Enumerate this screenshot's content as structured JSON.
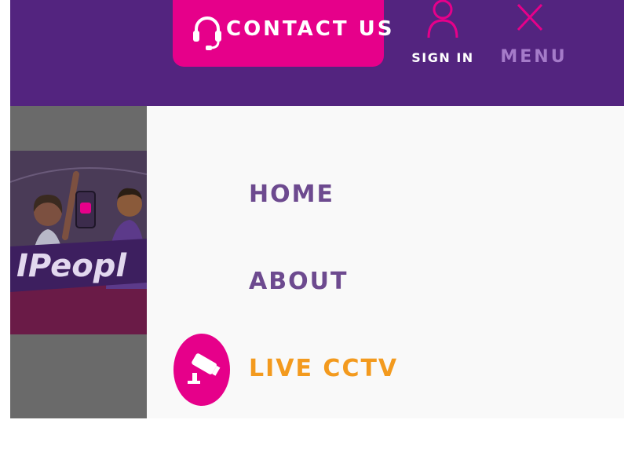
{
  "header": {
    "contact_label": "CONTACT US",
    "signin_label": "SIGN IN",
    "menu_label": "MENU",
    "icons": {
      "contact": "headset-icon",
      "signin": "user-icon",
      "menu": "close-icon"
    }
  },
  "hero": {
    "text": "IPeopl"
  },
  "drawer": {
    "items": [
      {
        "label": "HOME"
      },
      {
        "label": "ABOUT"
      },
      {
        "label": "LIVE CCTV",
        "icon": "cctv-camera-icon",
        "active": true
      }
    ]
  },
  "colors": {
    "brand_purple": "#53247f",
    "brand_pink": "#e6008a",
    "accent_orange": "#f39a1e",
    "nav_text": "#6d4a8f",
    "menu_label": "#a57bc9"
  }
}
